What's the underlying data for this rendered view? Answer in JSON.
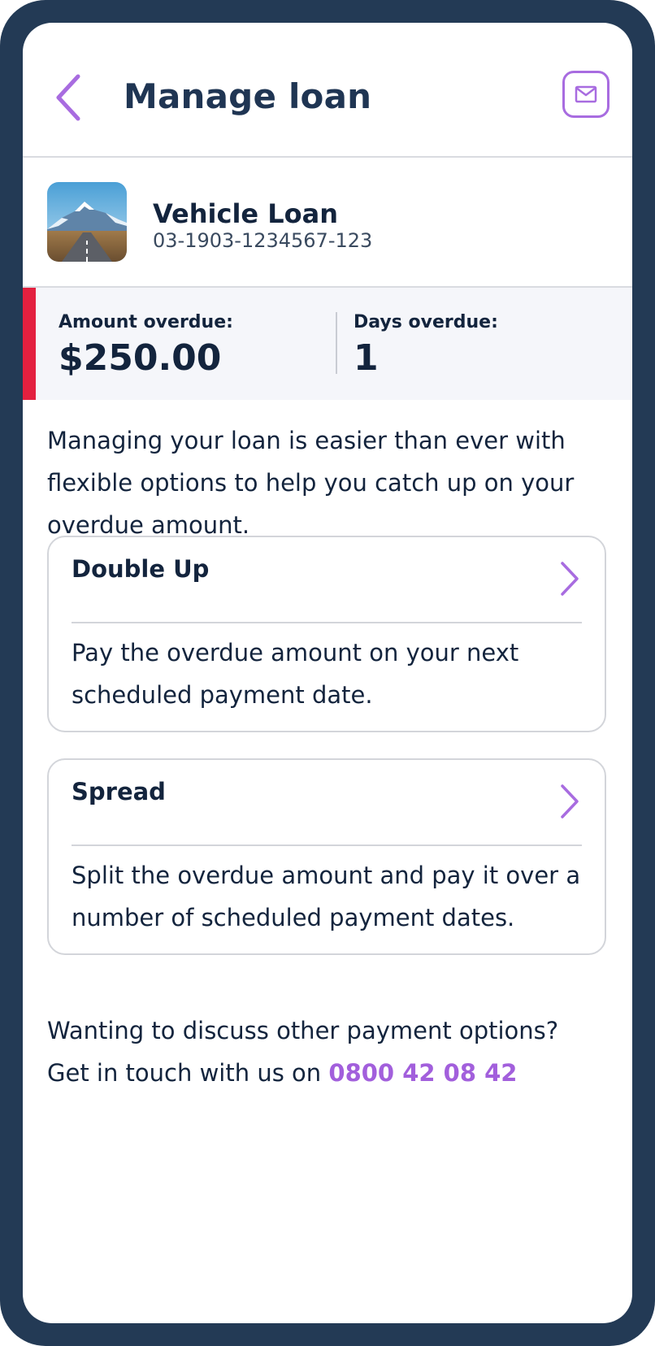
{
  "header": {
    "title": "Manage loan"
  },
  "loan": {
    "name": "Vehicle Loan",
    "number": "03-1903-1234567-123"
  },
  "overdue": {
    "amount_label": "Amount overdue:",
    "amount_value": "$250.00",
    "days_label": "Days overdue:",
    "days_value": "1"
  },
  "intro": "Managing your loan is easier than ever with flexible options to help you catch up on your overdue amount.",
  "options": [
    {
      "title": "Double Up",
      "description": "Pay the overdue amount on your next scheduled payment date."
    },
    {
      "title": "Spread",
      "description": "Split the overdue amount and pay it over a number of scheduled payment dates."
    }
  ],
  "contact": {
    "line1": "Wanting to discuss other payment options?",
    "line2_prefix": "Get in touch with us on",
    "phone": "0800 42 08 42"
  },
  "colors": {
    "frame": "#233a55",
    "accent": "#a86ce0",
    "alert": "#e3203f",
    "text": "#13243d"
  },
  "icons": {
    "back": "chevron-left-icon",
    "mail": "mail-icon",
    "chevron": "chevron-right-icon"
  }
}
